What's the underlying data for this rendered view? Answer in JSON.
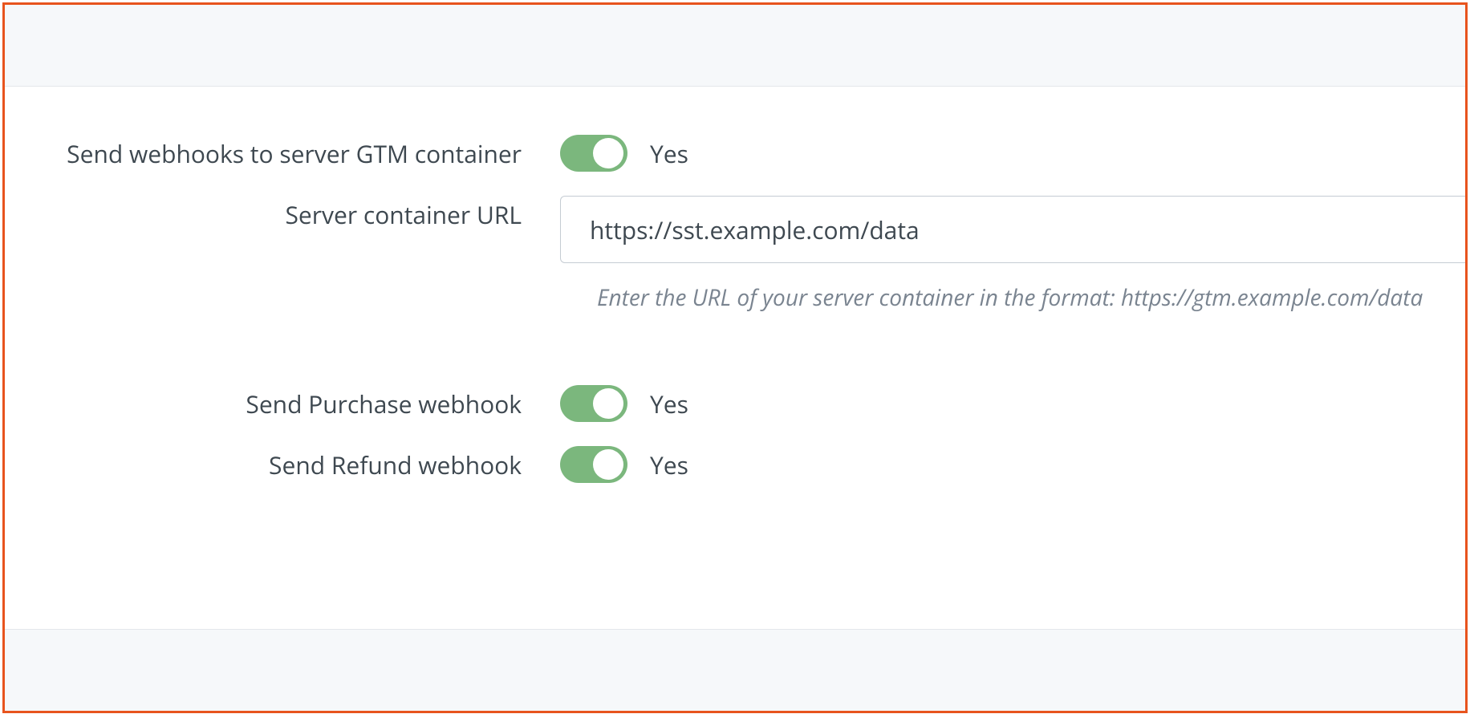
{
  "settings": {
    "sendWebhooks": {
      "label": "Send webhooks to server GTM container",
      "state": "Yes"
    },
    "serverUrl": {
      "label": "Server container URL",
      "value": "https://sst.example.com/data",
      "help": "Enter the URL of your server container in the format: https://gtm.example.com/data"
    },
    "sendPurchase": {
      "label": "Send Purchase webhook",
      "state": "Yes"
    },
    "sendRefund": {
      "label": "Send Refund webhook",
      "state": "Yes"
    }
  }
}
